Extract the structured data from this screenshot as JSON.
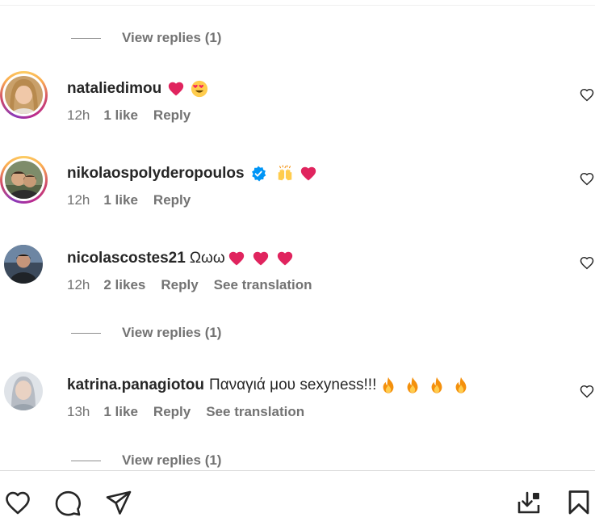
{
  "view_replies": [
    "View replies (1)",
    "View replies (1)",
    "View replies (1)"
  ],
  "comments": [
    {
      "username": "nataliedimou",
      "text": "",
      "emojis": [
        "red-heart",
        "heart-eyes"
      ],
      "verified": false,
      "time": "12h",
      "likes": "1 like",
      "reply": "Reply",
      "translate": ""
    },
    {
      "username": "nikolaospolyderopoulos",
      "text": "",
      "emojis": [
        "raising-hands",
        "red-heart"
      ],
      "verified": true,
      "time": "12h",
      "likes": "1 like",
      "reply": "Reply",
      "translate": ""
    },
    {
      "username": "nicolascostes21",
      "text": "Ωωω",
      "emojis": [
        "red-heart",
        "red-heart",
        "red-heart"
      ],
      "verified": false,
      "time": "12h",
      "likes": "2 likes",
      "reply": "Reply",
      "translate": "See translation"
    },
    {
      "username": "katrina.panagiotou",
      "text": "Παναγιά μου sexyness!!!",
      "emojis": [
        "fire",
        "fire",
        "fire",
        "fire"
      ],
      "verified": false,
      "time": "13h",
      "likes": "1 like",
      "reply": "Reply",
      "translate": "See translation"
    }
  ],
  "icons": {
    "like": "heart-outline-icon",
    "comment": "speech-bubble-icon",
    "share": "paper-plane-icon",
    "save_to_collection": "download-to-collection-icon",
    "bookmark": "bookmark-icon"
  },
  "colors": {
    "text": "#262626",
    "secondary": "#737373",
    "verified": "#0095f6",
    "heart": "#e0245e"
  }
}
